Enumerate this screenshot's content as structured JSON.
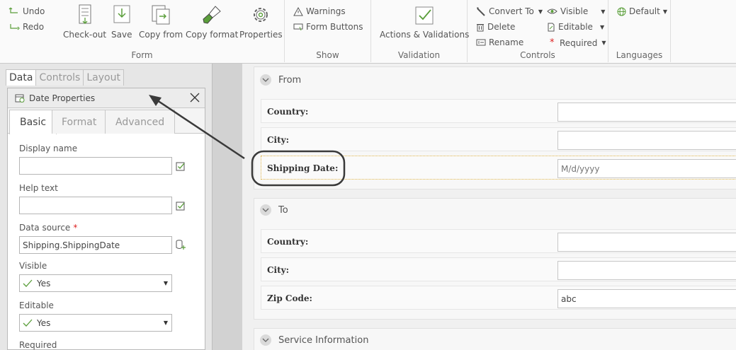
{
  "ribbon": {
    "form": {
      "label": "Form",
      "undo": "Undo",
      "redo": "Redo",
      "checkout": "Check-out",
      "save": "Save",
      "copy_from": "Copy from",
      "copy_format": "Copy format",
      "properties": "Properties"
    },
    "show": {
      "label": "Show",
      "warnings": "Warnings",
      "form_buttons": "Form Buttons"
    },
    "validation": {
      "label": "Validation",
      "actions": "Actions & Validations"
    },
    "controls": {
      "label": "Controls",
      "convert_to": "Convert To",
      "delete": "Delete",
      "rename": "Rename",
      "visible": "Visible",
      "editable": "Editable",
      "required": "Required"
    },
    "languages": {
      "label": "Languages",
      "default": "Default"
    }
  },
  "left_panel": {
    "tabs": [
      "Data",
      "Controls",
      "Layout"
    ],
    "props_title": "Date Properties",
    "sub_tabs": [
      "Basic",
      "Format",
      "Advanced"
    ],
    "fields": {
      "display_name_label": "Display name",
      "display_name_value": "",
      "help_text_label": "Help text",
      "help_text_value": "",
      "data_source_label": "Data source",
      "data_source_required": "*",
      "data_source_value": "Shipping.ShippingDate",
      "visible_label": "Visible",
      "visible_value": "Yes",
      "editable_label": "Editable",
      "editable_value": "Yes",
      "required_label": "Required"
    }
  },
  "form": {
    "from": {
      "title": "From",
      "country_label": "Country:",
      "country_value": "",
      "city_label": "City:",
      "city_value": "",
      "shipping_date_label": "Shipping Date:",
      "shipping_date_placeholder": "M/d/yyyy"
    },
    "to": {
      "title": "To",
      "country_label": "Country:",
      "country_value": "",
      "city_label": "City:",
      "city_value": "",
      "zip_label": "Zip Code:",
      "zip_value": "abc"
    },
    "service": {
      "title": "Service Information"
    }
  },
  "colors": {
    "accent_green": "#5a9e3a",
    "required_red": "#d22222",
    "highlight_dots": "#e0b64a"
  }
}
